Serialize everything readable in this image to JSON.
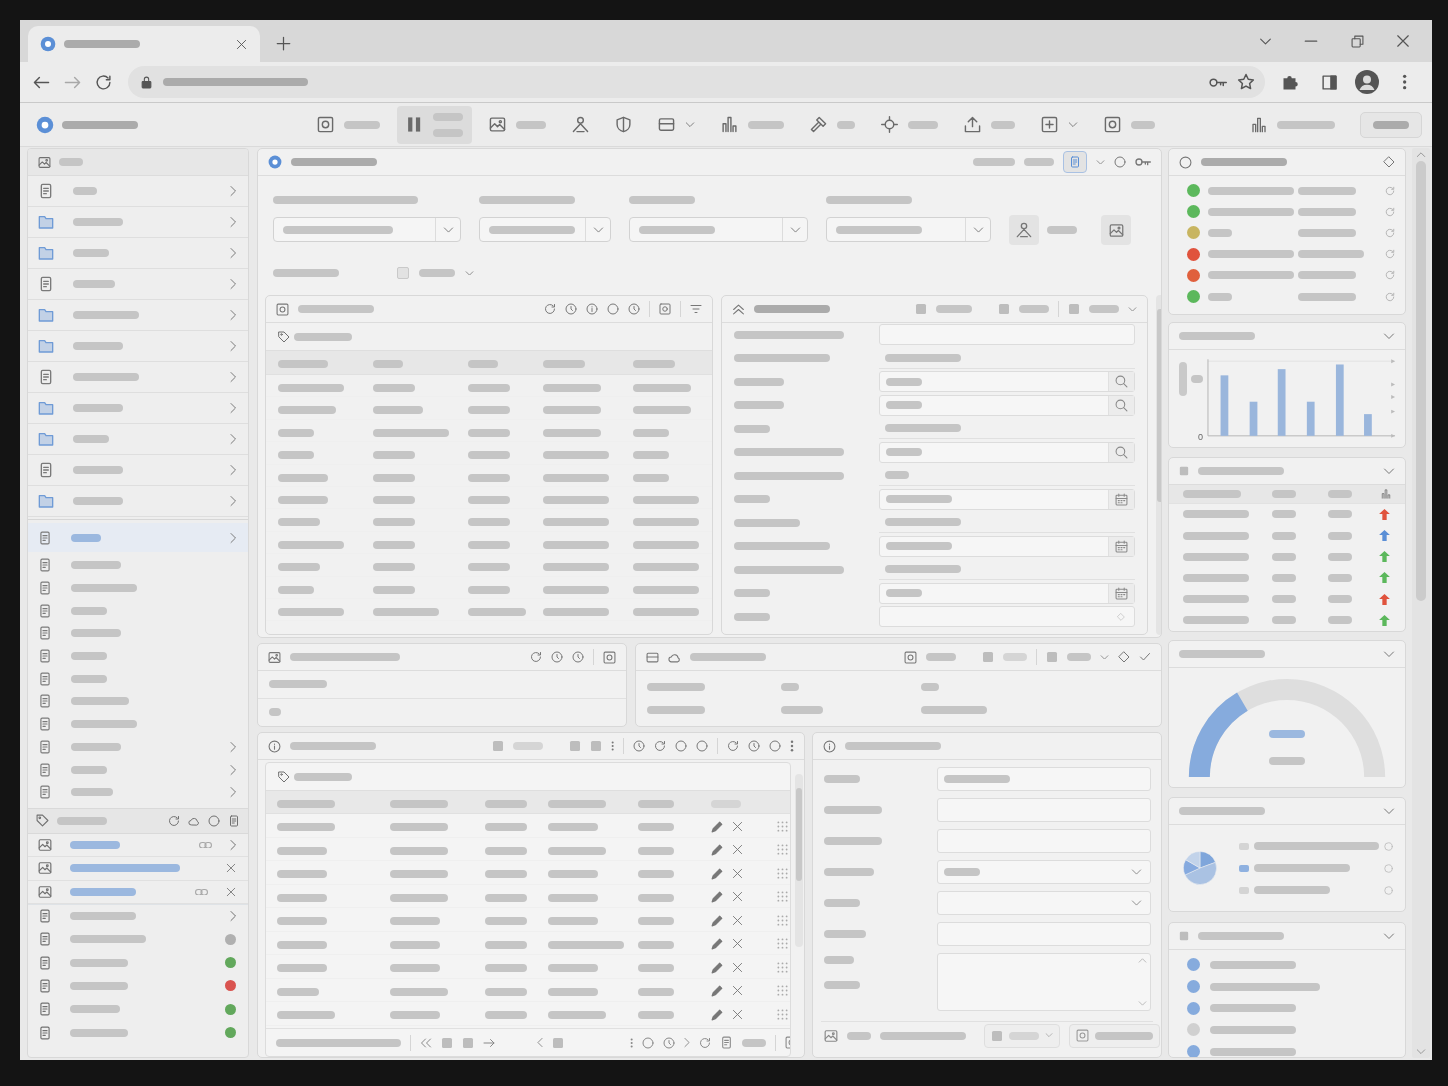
{
  "browser": {
    "tabs": [
      {
        "selected": true
      }
    ],
    "secure": true
  },
  "app_toolbar": [
    {
      "kind": "labeled",
      "selected": false
    },
    {
      "kind": "stacked",
      "selected": true
    },
    {
      "kind": "labeled",
      "selected": false
    },
    {
      "kind": "icon",
      "selected": false
    },
    {
      "kind": "icon",
      "selected": false
    },
    {
      "kind": "dropdown",
      "selected": false
    },
    {
      "kind": "labeled",
      "selected": false
    },
    {
      "kind": "labeled",
      "selected": false
    },
    {
      "kind": "labeled",
      "selected": false
    },
    {
      "kind": "labeled",
      "selected": false
    },
    {
      "kind": "dropdown",
      "selected": false
    },
    {
      "kind": "labeled",
      "selected": false
    }
  ],
  "sidebar": {
    "groups": [
      {
        "kind": "nav",
        "items": [
          {
            "selected": false,
            "expandable": true
          },
          {
            "selected": false,
            "expandable": true
          },
          {
            "selected": false,
            "expandable": true
          },
          {
            "selected": false,
            "expandable": true
          },
          {
            "selected": false,
            "expandable": true
          },
          {
            "selected": false,
            "expandable": true
          },
          {
            "selected": false,
            "expandable": true
          },
          {
            "selected": false,
            "expandable": true
          },
          {
            "selected": false,
            "expandable": true
          },
          {
            "selected": false,
            "expandable": true
          },
          {
            "selected": false,
            "expandable": true
          }
        ]
      },
      {
        "kind": "list",
        "items": [
          {
            "selected": true,
            "expandable": true
          },
          {
            "selected": false,
            "expandable": false
          },
          {
            "selected": false,
            "expandable": false
          },
          {
            "selected": false,
            "expandable": false
          },
          {
            "selected": false,
            "expandable": false
          },
          {
            "selected": false,
            "expandable": false
          },
          {
            "selected": false,
            "expandable": false
          },
          {
            "selected": false,
            "expandable": false
          },
          {
            "selected": false,
            "expandable": false
          },
          {
            "selected": false,
            "expandable": true
          },
          {
            "selected": false,
            "expandable": true
          },
          {
            "selected": false,
            "expandable": true
          }
        ]
      }
    ],
    "favorites": [
      {
        "open": true,
        "linked": true,
        "closable": false
      },
      {
        "open": true,
        "linked": false,
        "closable": true
      },
      {
        "open": true,
        "linked": true,
        "closable": true
      }
    ],
    "recent": [
      {
        "kind": "expandable"
      },
      {
        "kind": "status",
        "color": "#b0b0b0"
      },
      {
        "kind": "status",
        "color": "#62a85c"
      },
      {
        "kind": "status",
        "color": "#d9534f"
      },
      {
        "kind": "status",
        "color": "#62a85c"
      },
      {
        "kind": "status",
        "color": "#62a85c"
      }
    ]
  },
  "search_card": {
    "filters": [
      {
        "filled": true
      },
      {
        "filled": true
      },
      {
        "filled": true
      },
      {
        "filled": true
      }
    ],
    "option": {
      "checked": false
    },
    "results": {
      "rows": [
        {
          "selected": false
        },
        {
          "selected": false
        },
        {
          "selected": false
        },
        {
          "selected": false
        },
        {
          "selected": false
        },
        {
          "selected": false
        },
        {
          "selected": false
        },
        {
          "selected": false
        },
        {
          "selected": false
        },
        {
          "selected": false
        },
        {
          "selected": false
        }
      ]
    },
    "details": [
      {
        "kind": "text",
        "filled": false
      },
      {
        "kind": "readonly",
        "filled": true
      },
      {
        "kind": "search",
        "filled": true
      },
      {
        "kind": "search",
        "filled": true
      },
      {
        "kind": "readonly",
        "filled": true
      },
      {
        "kind": "search",
        "filled": true
      },
      {
        "kind": "readonly",
        "filled": true
      },
      {
        "kind": "date",
        "filled": true
      },
      {
        "kind": "readonly",
        "filled": true
      },
      {
        "kind": "date",
        "filled": true
      },
      {
        "kind": "readonly",
        "filled": true
      },
      {
        "kind": "date",
        "filled": true
      },
      {
        "kind": "spin",
        "filled": false
      }
    ]
  },
  "items_grid": {
    "rows": [
      {
        "selected": false
      },
      {
        "selected": false
      },
      {
        "selected": false
      },
      {
        "selected": false
      },
      {
        "selected": false
      },
      {
        "selected": false
      },
      {
        "selected": false
      },
      {
        "selected": false
      },
      {
        "selected": false
      }
    ]
  },
  "detail_form": [
    {
      "kind": "text",
      "filled": true
    },
    {
      "kind": "text",
      "filled": false
    },
    {
      "kind": "text",
      "filled": false
    },
    {
      "kind": "select",
      "filled": true
    },
    {
      "kind": "select",
      "filled": false
    },
    {
      "kind": "text",
      "filled": false
    },
    {
      "kind": "textarea",
      "filled": false
    }
  ],
  "status_list": [
    {
      "color": "#5cb85c"
    },
    {
      "color": "#5cb85c"
    },
    {
      "color": "#c8b560"
    },
    {
      "color": "#e0533d"
    },
    {
      "color": "#e0603d"
    },
    {
      "color": "#5cb85c"
    }
  ],
  "bar_chart": {
    "y_tick_labels": [
      "0"
    ]
  },
  "ranking": [
    {
      "color": "#e0533d"
    },
    {
      "color": "#5b8fd6"
    },
    {
      "color": "#5cb85c"
    },
    {
      "color": "#5cb85c"
    },
    {
      "color": "#e0533d"
    },
    {
      "color": "#5cb85c"
    }
  ],
  "gauge": {
    "level": 0.33
  },
  "pie_legend": [
    {
      "color": "#d4d4d4"
    },
    {
      "color": "#8fb1e0"
    },
    {
      "color": "#d4d4d4"
    }
  ],
  "checklist": [
    {
      "checked": true
    },
    {
      "checked": true
    },
    {
      "checked": true
    },
    {
      "checked": false
    },
    {
      "checked": true
    }
  ]
}
